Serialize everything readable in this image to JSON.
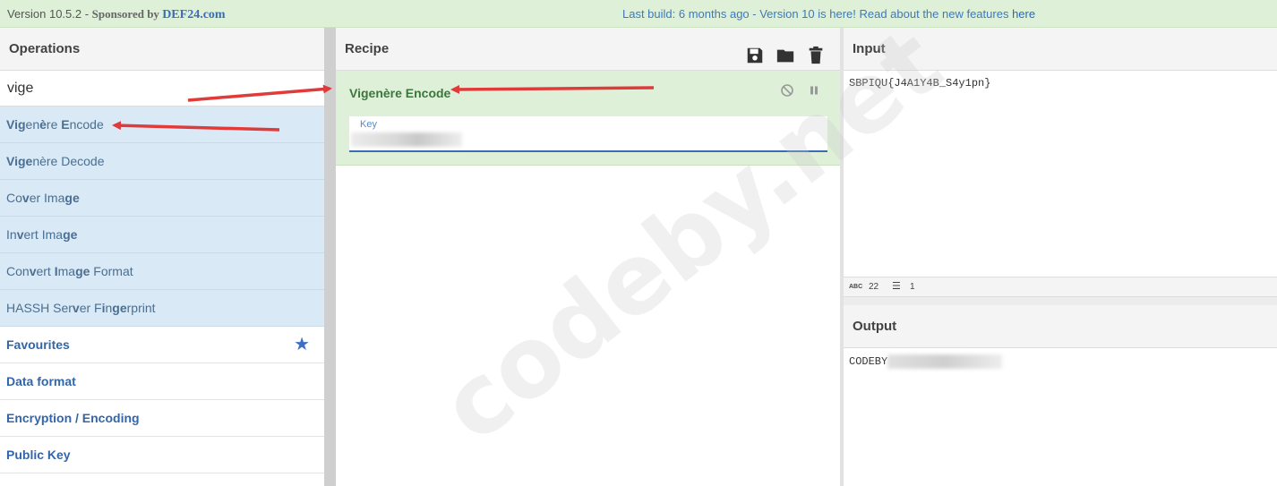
{
  "banner": {
    "version": "Version 10.5.2 - ",
    "sponsor": "Sponsored by ",
    "sponsor_name": "DEF24.com",
    "build_text": "Last build: 6 months ago - Version 10 is here! Read about the new features ",
    "build_link": "here"
  },
  "operations": {
    "title": "Operations",
    "search_value": "vige",
    "results": [
      {
        "label_html": "<b>Vig</b>en<b>è</b>re <b>E</b>ncode",
        "text": "Vigenère Encode"
      },
      {
        "label_html": "<b>Vige</b>nère Decode",
        "text": "Vigenère Decode"
      },
      {
        "label_html": "Co<b>v</b>er Ima<b>ge</b>",
        "text": "Cover Image"
      },
      {
        "label_html": "In<b>v</b>ert Ima<b>ge</b>",
        "text": "Invert Image"
      },
      {
        "label_html": "Con<b>v</b>ert <b>I</b>ma<b>ge</b> Format",
        "text": "Convert Image Format"
      },
      {
        "label_html": "HASSH Ser<b>v</b>er F<b>i</b>n<b>ge</b>rprint",
        "text": "HASSH Server Fingerprint"
      }
    ],
    "categories": [
      "Favourites",
      "Data format",
      "Encryption / Encoding",
      "Public Key"
    ]
  },
  "recipe": {
    "title": "Recipe",
    "operation_name": "Vigenère Encode",
    "key_label": "Key",
    "icons": [
      "save-icon",
      "folder-icon",
      "trash-icon"
    ]
  },
  "input": {
    "title": "Input",
    "value": "SBPIQU{J4A1Y4B_S4y1pn}",
    "length": "22",
    "lines": "1",
    "length_icon": "abc-icon"
  },
  "output": {
    "title": "Output",
    "value_visible": "CODEBY"
  },
  "watermark": "codeby.net",
  "colors": {
    "banner_bg": "#dff0d8",
    "op_result_bg": "#d9e9f5",
    "recipe_card_bg": "#dff0d8",
    "recipe_op_text": "#3c763d",
    "category_text": "#3366a8",
    "arrow": "#e03a3a"
  }
}
